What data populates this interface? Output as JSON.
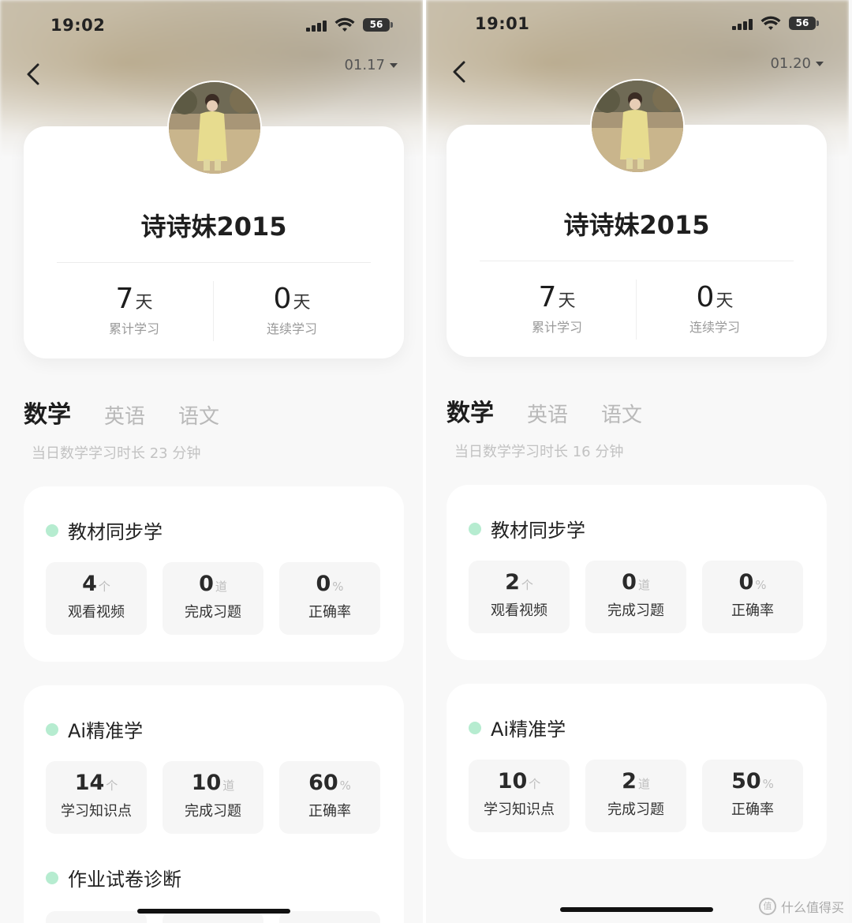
{
  "screens": [
    {
      "status": {
        "time": "19:02",
        "battery": "56"
      },
      "date": "01.17",
      "profile": {
        "name": "诗诗妹2015",
        "total_days": "7",
        "total_unit": "天",
        "total_label": "累计学习",
        "streak_days": "0",
        "streak_unit": "天",
        "streak_label": "连续学习"
      },
      "tabs": [
        "数学",
        "英语",
        "语文"
      ],
      "study_time": "当日数学学习时长 23 分钟",
      "textbook": {
        "title": "教材同步学",
        "metrics": [
          {
            "value": "4",
            "unit": "个",
            "label": "观看视频"
          },
          {
            "value": "0",
            "unit": "道",
            "label": "完成习题"
          },
          {
            "value": "0",
            "unit": "%",
            "label": "正确率"
          }
        ]
      },
      "ai": {
        "title": "Ai精准学",
        "metrics": [
          {
            "value": "14",
            "unit": "个",
            "label": "学习知识点"
          },
          {
            "value": "10",
            "unit": "道",
            "label": "完成习题"
          },
          {
            "value": "60",
            "unit": "%",
            "label": "正确率"
          }
        ]
      },
      "homework": {
        "title": "作业试卷诊断"
      }
    },
    {
      "status": {
        "time": "19:01",
        "battery": "56"
      },
      "date": "01.20",
      "profile": {
        "name": "诗诗妹2015",
        "total_days": "7",
        "total_unit": "天",
        "total_label": "累计学习",
        "streak_days": "0",
        "streak_unit": "天",
        "streak_label": "连续学习"
      },
      "tabs": [
        "数学",
        "英语",
        "语文"
      ],
      "study_time": "当日数学学习时长 16 分钟",
      "textbook": {
        "title": "教材同步学",
        "metrics": [
          {
            "value": "2",
            "unit": "个",
            "label": "观看视频"
          },
          {
            "value": "0",
            "unit": "道",
            "label": "完成习题"
          },
          {
            "value": "0",
            "unit": "%",
            "label": "正确率"
          }
        ]
      },
      "ai": {
        "title": "Ai精准学",
        "metrics": [
          {
            "value": "10",
            "unit": "个",
            "label": "学习知识点"
          },
          {
            "value": "2",
            "unit": "道",
            "label": "完成习题"
          },
          {
            "value": "50",
            "unit": "%",
            "label": "正确率"
          }
        ]
      }
    }
  ],
  "watermark": {
    "text": "什么值得买",
    "icon": "值"
  },
  "colors": {
    "accent": "#8ee3b6",
    "dot": "#b6ecd0"
  }
}
